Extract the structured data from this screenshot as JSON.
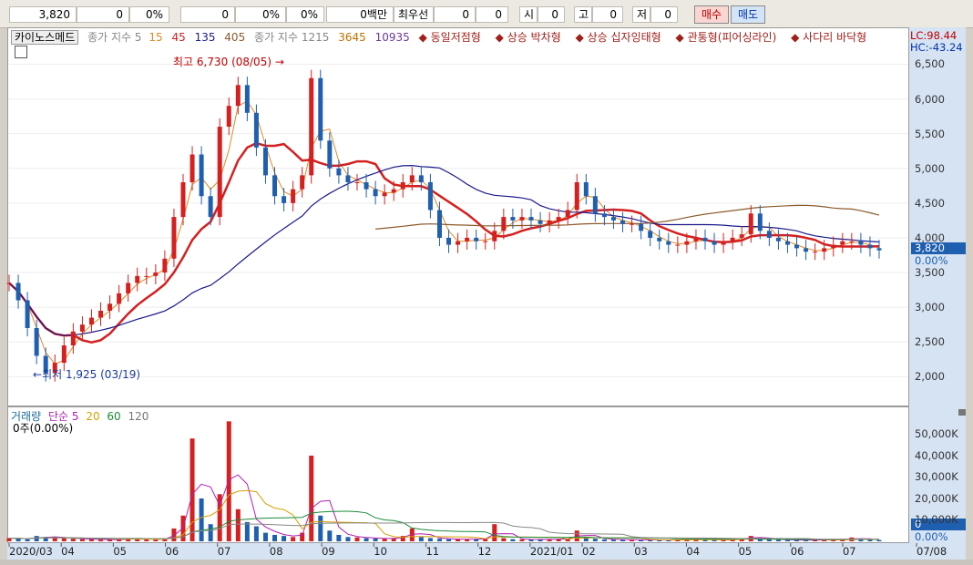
{
  "top_bar": {
    "price": "3,820",
    "change": "0",
    "change_pct": "0%",
    "volume": "0",
    "vol_pct1": "0%",
    "vol_pct2": "0%",
    "amount_label": "0백만",
    "best_label": "최우선",
    "best_ask": "0",
    "best_bid": "0",
    "open_label": "시",
    "open_value": "0",
    "high_label": "고",
    "high_value": "0",
    "low_label": "저",
    "low_value": "0",
    "buy_label": "매수",
    "sell_label": "매도"
  },
  "legend": {
    "stock_name": "카이노스메드",
    "price_ma_label": "종가 지수 5",
    "price_ma_15": "15",
    "price_ma_45": "45",
    "price_ma_135": "135",
    "price_ma_405": "405",
    "price_ma2_label": "종가 지수 1215",
    "price_ma2_3645": "3645",
    "price_ma2_10935": "10935",
    "pattern1": "동일저점형",
    "pattern2": "상승 박차형",
    "pattern3": "상승 십자잉태형",
    "pattern4": "관통형(피어싱라인)",
    "pattern5": "사다리 바닥형",
    "lc": "LC:98.44",
    "hc": "HC:-43.24"
  },
  "volume_legend": {
    "title": "거래량",
    "ma_label": "단순 5",
    "ma20": "20",
    "ma60": "60",
    "ma120": "120",
    "current": "0주(0.00%)"
  },
  "annotations": {
    "high": "최고 6,730 (08/05)",
    "low": "최저 1,925 (03/19)"
  },
  "current_price_tag": "3,820",
  "current_pct_tag": "0.00%",
  "current_vol_tag": "0",
  "current_vol_pct": "0.00%",
  "colors": {
    "up": "#d42020",
    "down": "#1f5fb0",
    "ma_red": "#d42020",
    "ma_navy": "#1a1a8a",
    "ma_brown": "#8b5a2b",
    "ma_orange": "#e08a20"
  },
  "chart_data": [
    {
      "type": "line",
      "title": "",
      "price_axis_ticks": [
        6500,
        6000,
        5500,
        5000,
        4500,
        4000,
        3500,
        3000,
        2500,
        2000
      ],
      "ylim": [
        1650,
        6900
      ],
      "x_ticks": [
        "2020/03",
        "04",
        "05",
        "06",
        "07",
        "08",
        "09",
        "10",
        "11",
        "12",
        "2021/01",
        "02",
        "03",
        "04",
        "05",
        "06",
        "07",
        "07/08"
      ],
      "series": [
        {
          "name": "종가",
          "values": [
            3350,
            3100,
            2700,
            2300,
            2050,
            2200,
            2450,
            2650,
            2750,
            2850,
            2950,
            3050,
            3200,
            3350,
            3450,
            3450,
            3500,
            3700,
            4300,
            4800,
            5200,
            4600,
            4300,
            5600,
            5900,
            6200,
            5800,
            5300,
            4900,
            4600,
            4500,
            4700,
            4900,
            6300,
            5400,
            5000,
            4900,
            4800,
            4800,
            4700,
            4600,
            4650,
            4700,
            4800,
            4900,
            4800,
            4400,
            4000,
            3900,
            3950,
            4000,
            3950,
            3950,
            4100,
            4300,
            4250,
            4300,
            4250,
            4200,
            4250,
            4300,
            4400,
            4800,
            4600,
            4350,
            4300,
            4250,
            4200,
            4200,
            4100,
            4000,
            3950,
            3900,
            3900,
            3950,
            4000,
            3950,
            3900,
            3950,
            4000,
            4050,
            4350,
            4100,
            4000,
            3950,
            3900,
            3850,
            3800,
            3800,
            3850,
            3900,
            3950,
            3950,
            3900,
            3850,
            3820
          ]
        }
      ]
    },
    {
      "type": "bar",
      "title": "",
      "volume_axis_ticks": [
        "50,000K",
        "40,000K",
        "30,000K",
        "20,000K",
        "10,000K"
      ],
      "ylim": [
        0,
        57000
      ],
      "values_k": [
        1500,
        1200,
        1000,
        2500,
        2000,
        1800,
        1500,
        1200,
        1000,
        900,
        800,
        700,
        900,
        1500,
        1200,
        1000,
        800,
        1000,
        6000,
        12000,
        48000,
        20000,
        8000,
        22000,
        56000,
        15000,
        9000,
        7000,
        4000,
        3000,
        2500,
        2000,
        4000,
        40000,
        12000,
        5000,
        3000,
        2000,
        1800,
        1500,
        1300,
        1200,
        1500,
        2500,
        6000,
        2000,
        1500,
        1200,
        1000,
        900,
        1000,
        1100,
        1200,
        8000,
        1500,
        1000,
        900,
        800,
        900,
        1000,
        1100,
        1200,
        5000,
        2000,
        1200,
        900,
        800,
        700,
        700,
        700,
        600,
        600,
        600,
        700,
        900,
        1100,
        700,
        600,
        700,
        800,
        1500,
        2500,
        1200,
        900,
        700,
        600,
        600,
        600,
        600,
        700,
        800,
        900,
        1800,
        1000,
        700,
        600
      ]
    }
  ]
}
